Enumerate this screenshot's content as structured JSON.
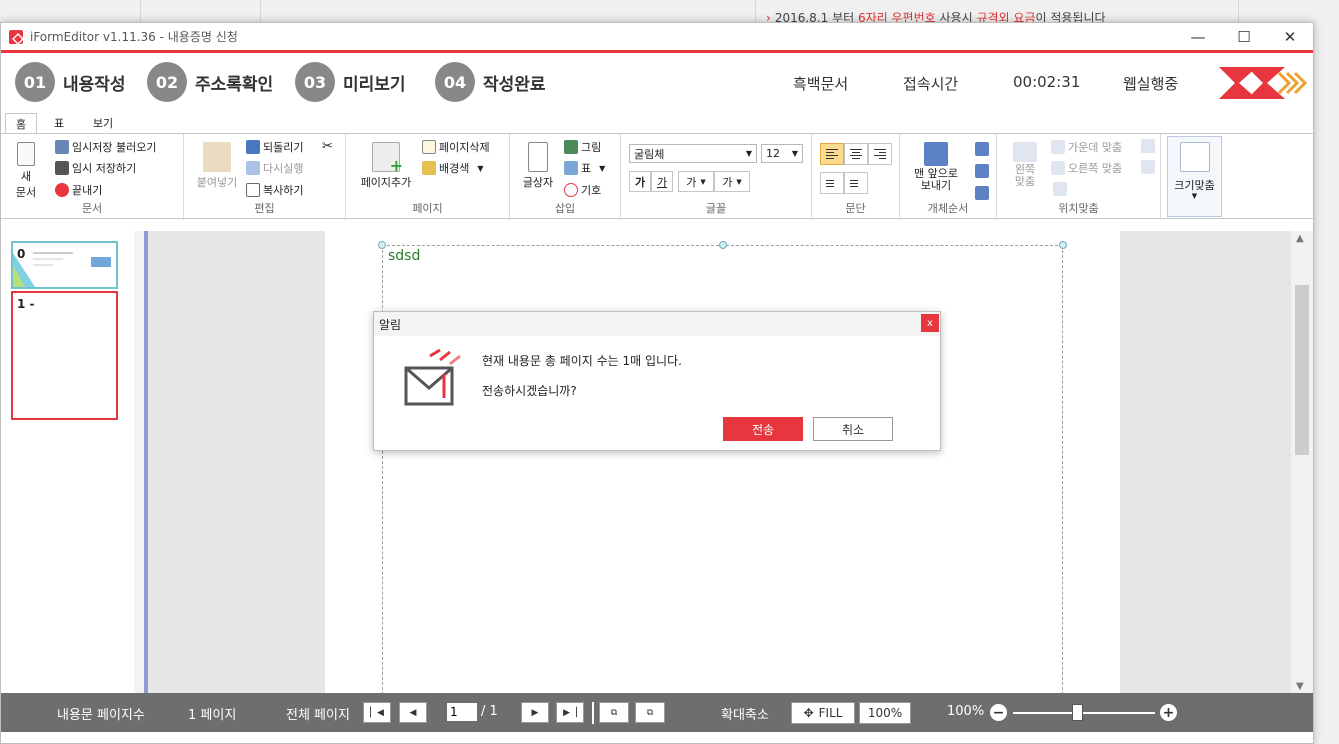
{
  "background": {
    "notice_prefix": "2016.8.1 부터",
    "notice_red1": "6자리 우편번호",
    "notice_mid": "사용시",
    "notice_red2": "규격외 요금",
    "notice_suffix": "이 적용됩니다"
  },
  "window": {
    "title": "iFormEditor v1.11.36 - 내용증명 신청",
    "minimize": "—",
    "maximize": "☐",
    "close": "✕"
  },
  "steps": [
    {
      "num": "01",
      "label": "내용작성"
    },
    {
      "num": "02",
      "label": "주소록확인"
    },
    {
      "num": "03",
      "label": "미리보기"
    },
    {
      "num": "04",
      "label": "작성완료"
    }
  ],
  "header": {
    "doc_mode": "흑백문서",
    "conn_label": "접속시간",
    "conn_time": "00:02:31",
    "web_status": "웹실행중"
  },
  "ribbon_tabs": [
    "홈",
    "표",
    "보기"
  ],
  "ribbon": {
    "doc": {
      "new": "새\n문서",
      "load_temp": "임시저장 불러오기",
      "save_temp": "임시 저장하기",
      "exit": "끝내기",
      "label": "문서"
    },
    "edit": {
      "paste": "붙여넣기",
      "undo": "되돌리기",
      "redo": "다시실행",
      "copy": "복사하기",
      "label": "편집"
    },
    "page": {
      "add": "페이지추가",
      "delete": "페이지삭제",
      "bgcolor": "배경색",
      "label": "페이지"
    },
    "insert": {
      "textbox": "글상자",
      "image": "그림",
      "table": "표",
      "symbol": "기호",
      "label": "삽입"
    },
    "font": {
      "face": "굴림체",
      "size": "12",
      "bold": "가",
      "underline": "가",
      "shrink": "가",
      "color": "가",
      "label": "글꼴"
    },
    "para": {
      "label": "문단"
    },
    "order": {
      "front": "맨 앞으로\n보내기",
      "label": "개체순서"
    },
    "position": {
      "left": "왼쪽\n맞춤",
      "center": "가운데 맞춤",
      "right": "오른쪽 맞춤",
      "label": "위치맞춤"
    },
    "fit": {
      "label": "크기맞춤"
    }
  },
  "thumbnails": [
    {
      "num": "0"
    },
    {
      "num": "1",
      "text": "-"
    }
  ],
  "document": {
    "text": "sdsd"
  },
  "status": {
    "pages_label": "내용문 페이지수",
    "pages_value": "1 페이지",
    "total_label": "전체 페이지",
    "current_page": "1",
    "total_pages": "/ 1",
    "zoom_label": "확대축소",
    "fill": "FILL",
    "zoom_100": "100%",
    "zoom_value": "100%",
    "zoom_level": 0.45
  },
  "dialog": {
    "title": "알림",
    "close": "x",
    "message1": "현재 내용문 총 페이지 수는 1매 입니다.",
    "message2": "전송하시겠습니까?",
    "ok": "전송",
    "cancel": "취소"
  },
  "colors": {
    "accent": "#e8363f",
    "step_circle": "#888888",
    "thumb_border": "#8e9bd6"
  }
}
